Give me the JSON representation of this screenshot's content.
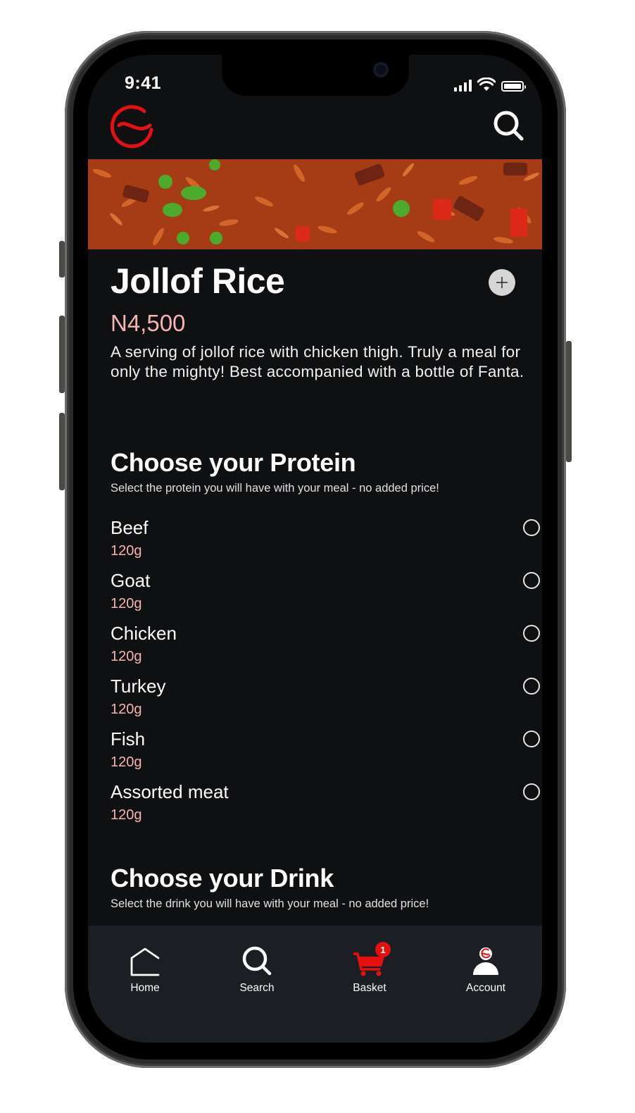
{
  "status_bar": {
    "time": "9:41"
  },
  "colors": {
    "accent_red": "#e61010",
    "price_pink": "#f7b3b0",
    "background": "#0f1012",
    "tabbar": "#1b1e22"
  },
  "header": {
    "logo_icon": "g-logo-icon",
    "search_icon": "search-icon"
  },
  "dish": {
    "name": "Jollof Rice",
    "price": "N4,500",
    "description": "A serving of jollof rice with chicken thigh. Truly a meal for only the mighty! Best accompanied with a bottle of Fanta."
  },
  "protein_section": {
    "title": "Choose your Protein",
    "subtitle": "Select the protein you will have with your meal - no added price!",
    "options": [
      {
        "name": "Beef",
        "weight": "120g"
      },
      {
        "name": "Goat",
        "weight": "120g"
      },
      {
        "name": "Chicken",
        "weight": "120g"
      },
      {
        "name": "Turkey",
        "weight": "120g"
      },
      {
        "name": "Fish",
        "weight": "120g"
      },
      {
        "name": "Assorted meat",
        "weight": "120g"
      }
    ]
  },
  "drink_section": {
    "title": "Choose your Drink",
    "subtitle": "Select the drink you will have with your meal - no added price!"
  },
  "tabbar": {
    "home": "Home",
    "search": "Search",
    "basket": "Basket",
    "basket_count": "1",
    "account": "Account"
  }
}
